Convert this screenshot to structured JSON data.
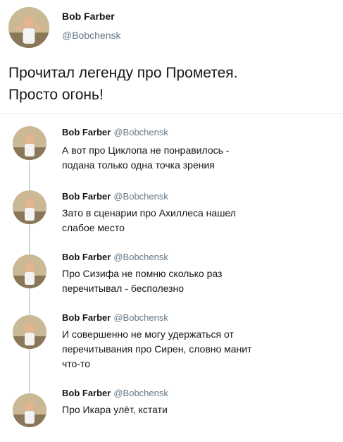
{
  "main_tweet": {
    "name": "Bob Farber",
    "handle": "@Bobchensk",
    "text_line1": "Прочитал легенду про Прометея.",
    "text_line2": "Просто огонь!"
  },
  "replies": [
    {
      "name": "Bob Farber",
      "handle": "@Bobchensk",
      "line1": "А вот про Циклопа не понравилось -",
      "line2": "подана только одна точка зрения"
    },
    {
      "name": "Bob Farber",
      "handle": "@Bobchensk",
      "line1": "Зато в сценарии про Ахиллеса нашел",
      "line2": "слабое место"
    },
    {
      "name": "Bob Farber",
      "handle": "@Bobchensk",
      "line1": "Про Сизифа не помню сколько раз",
      "line2": "перечитывал - бесполезно"
    },
    {
      "name": "Bob Farber",
      "handle": "@Bobchensk",
      "line1": "И совершенно не могу удержаться от",
      "line2": "перечитывания про Сирен, словно манит",
      "line3": "что-то"
    },
    {
      "name": "Bob Farber",
      "handle": "@Bobchensk",
      "line1": "Про Икара улёт, кстати"
    }
  ],
  "colors": {
    "text": "#14171a",
    "secondary": "#657786",
    "divider": "#e6ecf0"
  },
  "icons": {
    "avatar": "avatar-photo"
  }
}
